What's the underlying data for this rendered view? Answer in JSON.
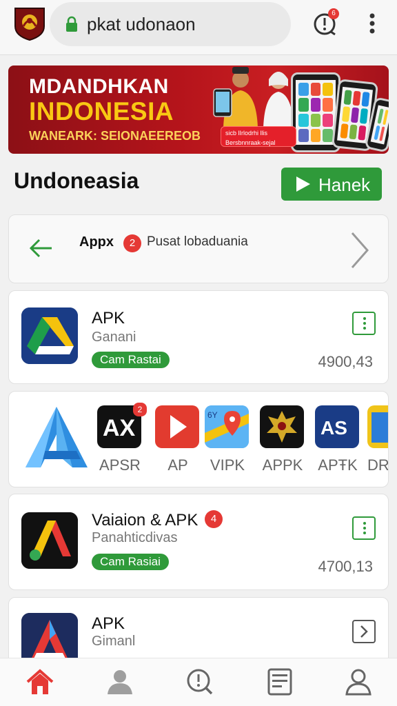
{
  "browser": {
    "url": "pkat udonaon",
    "notification_count": "6"
  },
  "banner": {
    "line1": "MDANDHKAN",
    "line2": "INDONESIA",
    "line3": "WANEARK: SEIONAEEREOB",
    "pill_line1": "sicb lIrlodrhi llis",
    "pill_line2": "Bersbnnraak-sejal"
  },
  "section": {
    "title": "Undoneasia",
    "action_label": "Hanek"
  },
  "nav_card": {
    "label": "Appx",
    "badge": "2",
    "text": "Pusat lobaduania"
  },
  "apps": [
    {
      "name": "APK",
      "subtitle": "Ganani",
      "tag": "Cam Rastai",
      "count": "4900,43"
    },
    {
      "name": "Vaiaion & APK",
      "badge": "4",
      "subtitle": "Panahticdivas",
      "tag": "Cam Rasiai",
      "count": "4700,13"
    },
    {
      "name": "APK",
      "subtitle": "Gimanl"
    }
  ],
  "carousel": {
    "items": [
      {
        "label": "APSR",
        "icon": "ax-icon",
        "badge": "2"
      },
      {
        "label": "AP",
        "icon": "play-store-icon"
      },
      {
        "label": "VIPK",
        "icon": "maps-icon"
      },
      {
        "label": "APPK",
        "icon": "garuda-icon"
      },
      {
        "label": "APŦK",
        "icon": "as-icon"
      },
      {
        "label": "DR",
        "icon": "dr-icon"
      }
    ]
  },
  "colors": {
    "accent_green": "#2f9a3a",
    "badge_red": "#e53935",
    "banner_red": "#b5141b",
    "banner_yellow": "#f9c813"
  }
}
